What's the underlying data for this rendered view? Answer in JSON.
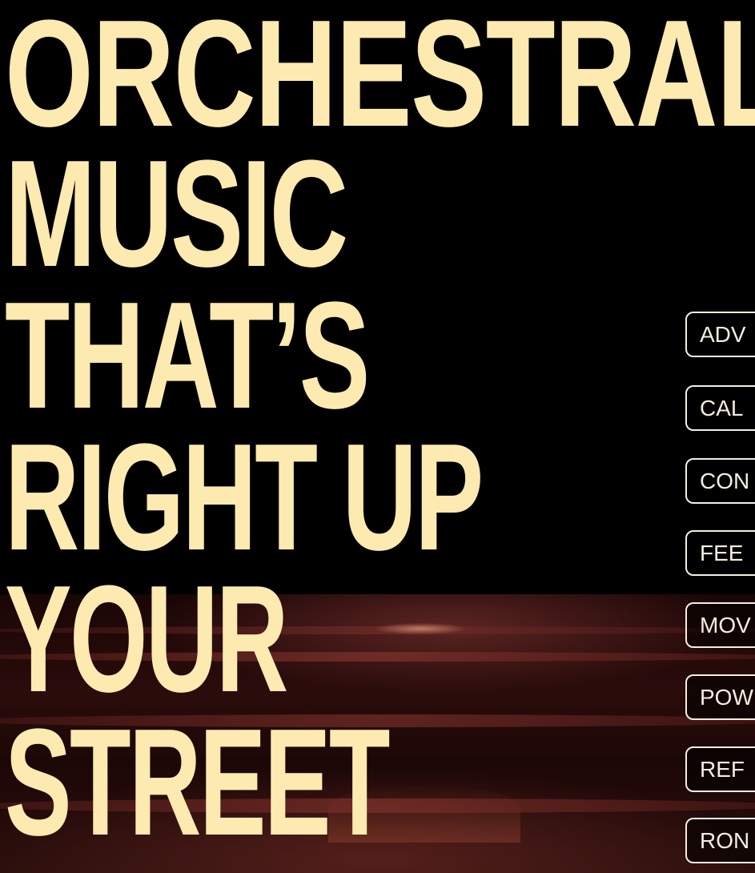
{
  "hero": {
    "headline_lines": [
      "ORCHESTRAL",
      "MUSIC",
      "THAT’S",
      "RIGHT UP",
      "YOUR",
      "STREET"
    ]
  },
  "categories": [
    "ADV",
    "CAL",
    "CON",
    "FEE",
    "MOV",
    "POW",
    "REF",
    "RON"
  ],
  "colors": {
    "background": "#000000",
    "headline": "#fdeab0",
    "pill_border": "#f4eedf",
    "pill_text": "#f4eedf"
  }
}
